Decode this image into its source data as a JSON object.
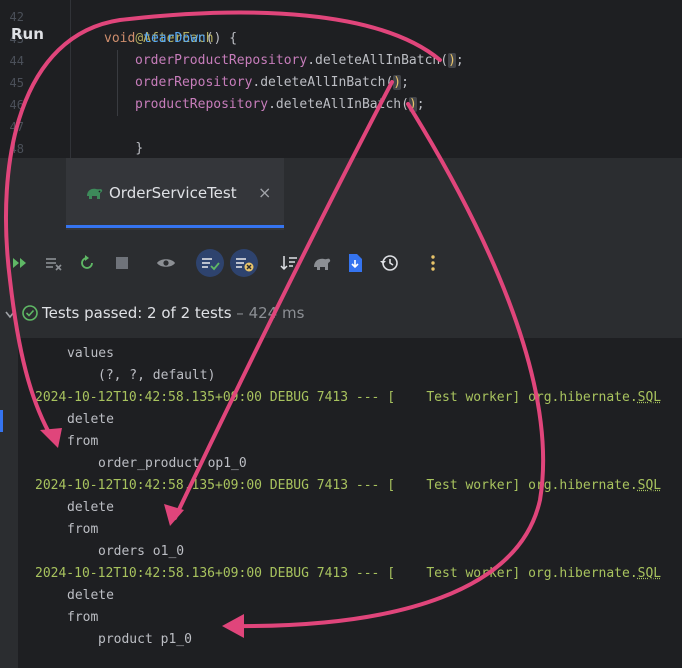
{
  "editor": {
    "line_numbers": [
      "42",
      "43",
      "44",
      "45",
      "46",
      "47",
      "48"
    ],
    "annotation": "@AfterEach",
    "method": {
      "keyword": "void",
      "name": "tearDown",
      "signature_rest": "() {"
    },
    "statements": [
      {
        "field": "orderProductRepository",
        "call": ".deleteAllInBatch",
        "open": "(",
        "close": ")",
        "end": ";"
      },
      {
        "field": "orderRepository",
        "call": ".deleteAllInBatch",
        "open": "(",
        "close": ")",
        "end": ";"
      },
      {
        "field": "productRepository",
        "call": ".deleteAllInBatch",
        "open": "(",
        "close": ")",
        "end": ";"
      }
    ],
    "closing_brace": "}"
  },
  "run_panel": {
    "title": "Run",
    "tab_label": "OrderServiceTest",
    "tab_icon": "gradle-elephant-icon",
    "close_glyph": "×"
  },
  "toolbar": {
    "icons": [
      "rerun-failed-icon",
      "clear-output-icon",
      "rerun-icon",
      "stop-icon",
      "show-passed-icon",
      "show-ignored-icon",
      "show-skipped-icon",
      "sort-icon",
      "gradle-icon",
      "export-icon",
      "history-icon",
      "more-icon"
    ]
  },
  "status": {
    "text": "Tests passed: 2 of 2 tests",
    "separator": " – ",
    "time": "424 ms"
  },
  "console": {
    "lines": [
      {
        "kind": "sql",
        "indent": 1,
        "text": "values"
      },
      {
        "kind": "sql",
        "indent": 2,
        "text": "(?, ?, default)"
      },
      {
        "kind": "log",
        "prefix": "2024-10-12T10:42:58.135+09:00 DEBUG 7413 --- [    Test worker] org.hibernate.",
        "tail": "SQL"
      },
      {
        "kind": "sql",
        "indent": 1,
        "text": "delete"
      },
      {
        "kind": "sql",
        "indent": 1,
        "text": "from"
      },
      {
        "kind": "sql",
        "indent": 2,
        "text": "order_product op1_0"
      },
      {
        "kind": "log",
        "prefix": "2024-10-12T10:42:58.135+09:00 DEBUG 7413 --- [    Test worker] org.hibernate.",
        "tail": "SQL"
      },
      {
        "kind": "sql",
        "indent": 1,
        "text": "delete"
      },
      {
        "kind": "sql",
        "indent": 1,
        "text": "from"
      },
      {
        "kind": "sql",
        "indent": 2,
        "text": "orders o1_0"
      },
      {
        "kind": "log",
        "prefix": "2024-10-12T10:42:58.136+09:00 DEBUG 7413 --- [    Test worker] org.hibernate.",
        "tail": "SQL"
      },
      {
        "kind": "sql",
        "indent": 1,
        "text": "delete"
      },
      {
        "kind": "sql",
        "indent": 1,
        "text": "from"
      },
      {
        "kind": "sql",
        "indent": 2,
        "text": "product p1_0"
      }
    ]
  },
  "colors": {
    "arrow": "#e0457b",
    "accent": "#3574f0",
    "log_green": "#a8c35e",
    "field_purple": "#c77dbb",
    "function_blue": "#56a8f5",
    "keyword_orange": "#cf8e6d",
    "annotation_yellow": "#b3ae60"
  }
}
